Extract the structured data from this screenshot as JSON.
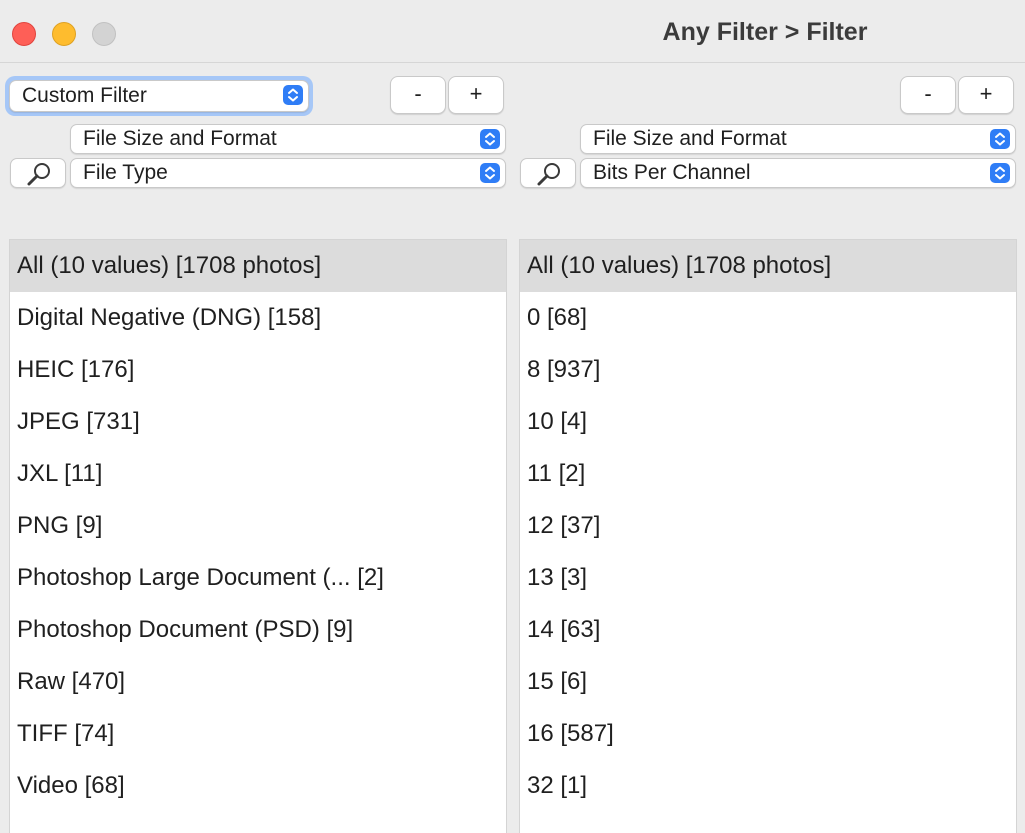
{
  "window": {
    "title": "Any Filter > Filter",
    "traffic_lights": {
      "close": "#fe5f57",
      "minimize": "#febc2e",
      "zoom": "#d3d3d3"
    }
  },
  "filter_mode": {
    "selected": "Custom Filter"
  },
  "accent_color": "#2f7df6",
  "left_pane": {
    "remove_label": "-",
    "add_label": "+",
    "category": "File Size and Format",
    "field": "File Type",
    "search_icon": "magnifier-icon",
    "items": [
      "All (10 values) [1708 photos]",
      "Digital Negative (DNG) [158]",
      "HEIC [176]",
      "JPEG [731]",
      "JXL [11]",
      "PNG [9]",
      "Photoshop Large Document (... [2]",
      "Photoshop Document (PSD) [9]",
      "Raw [470]",
      "TIFF [74]",
      "Video [68]"
    ],
    "selected_index": 0
  },
  "right_pane": {
    "remove_label": "-",
    "add_label": "+",
    "category": "File Size and Format",
    "field": "Bits Per Channel",
    "search_icon": "magnifier-icon",
    "items": [
      "All (10 values) [1708 photos]",
      "0 [68]",
      "8 [937]",
      "10 [4]",
      "11 [2]",
      "12 [37]",
      "13 [3]",
      "14 [63]",
      "15 [6]",
      "16 [587]",
      "32 [1]"
    ],
    "selected_index": 0
  }
}
